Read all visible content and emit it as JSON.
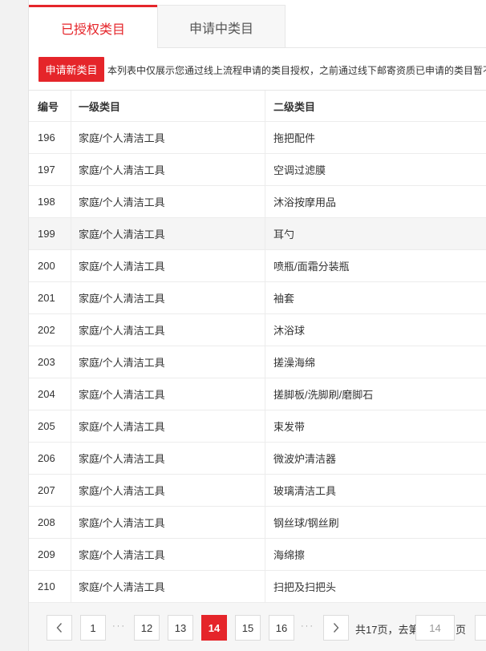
{
  "tabs": [
    {
      "label": "已授权类目",
      "active": true
    },
    {
      "label": "申请中类目",
      "active": false
    }
  ],
  "action_bar": {
    "apply_button": "申请新类目",
    "notice": "本列表中仅展示您通过线上流程申请的类目授权，之前通过线下邮寄资质已申请的类目暂不"
  },
  "table": {
    "headers": [
      "编号",
      "一级类目",
      "二级类目"
    ],
    "rows": [
      {
        "id": "196",
        "level1": "家庭/个人清洁工具",
        "level2": "拖把配件"
      },
      {
        "id": "197",
        "level1": "家庭/个人清洁工具",
        "level2": "空调过滤膜"
      },
      {
        "id": "198",
        "level1": "家庭/个人清洁工具",
        "level2": "沐浴按摩用品"
      },
      {
        "id": "199",
        "level1": "家庭/个人清洁工具",
        "level2": "耳勺"
      },
      {
        "id": "200",
        "level1": "家庭/个人清洁工具",
        "level2": "喷瓶/面霜分装瓶"
      },
      {
        "id": "201",
        "level1": "家庭/个人清洁工具",
        "level2": "袖套"
      },
      {
        "id": "202",
        "level1": "家庭/个人清洁工具",
        "level2": "沐浴球"
      },
      {
        "id": "203",
        "level1": "家庭/个人清洁工具",
        "level2": "搓澡海绵"
      },
      {
        "id": "204",
        "level1": "家庭/个人清洁工具",
        "level2": "搓脚板/洗脚刷/磨脚石"
      },
      {
        "id": "205",
        "level1": "家庭/个人清洁工具",
        "level2": "束发带"
      },
      {
        "id": "206",
        "level1": "家庭/个人清洁工具",
        "level2": "微波炉清洁器"
      },
      {
        "id": "207",
        "level1": "家庭/个人清洁工具",
        "level2": "玻璃清洁工具"
      },
      {
        "id": "208",
        "level1": "家庭/个人清洁工具",
        "level2": "钢丝球/钢丝刷"
      },
      {
        "id": "209",
        "level1": "家庭/个人清洁工具",
        "level2": "海绵擦"
      },
      {
        "id": "210",
        "level1": "家庭/个人清洁工具",
        "level2": "扫把及扫把头"
      }
    ]
  },
  "pagination": {
    "prev_icon": "chevron-left-icon",
    "next_icon": "chevron-right-icon",
    "pages": [
      "1",
      "12",
      "13",
      "14",
      "15",
      "16"
    ],
    "current_page": "14",
    "ellipsis": "···",
    "total_text": "共17页，去第",
    "input_value": "14",
    "page_suffix": "页",
    "accent_color": "#e5252a"
  }
}
